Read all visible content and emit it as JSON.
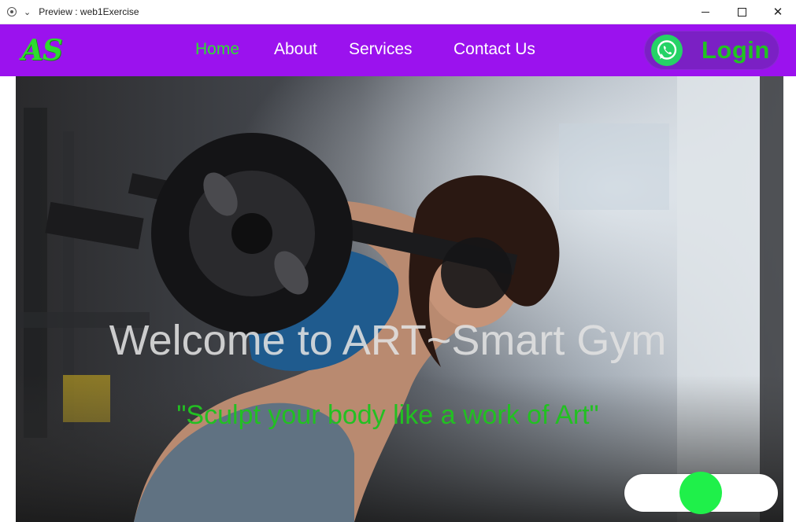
{
  "window": {
    "title": "Preview : web1Exercise",
    "chevron_icon": "chevron-down-icon",
    "record_icon": "record-icon"
  },
  "nav": {
    "logo": "AS",
    "links": [
      {
        "label": "Home",
        "active": true
      },
      {
        "label": "About",
        "active": false
      },
      {
        "label": "Services",
        "active": false
      },
      {
        "label": "Contact Us",
        "active": false
      }
    ],
    "login_label": "Login",
    "whatsapp_icon": "whatsapp-icon"
  },
  "hero": {
    "title": "Welcome to ART~Smart Gym",
    "tagline": "\"Sculpt your body like a work of Art\"",
    "image": "woman-lifting-barbell-in-gym"
  },
  "toggle": {
    "state": "on"
  },
  "colors": {
    "navbar": "#9b12ee",
    "accent_green": "#2ee02e",
    "toggle_knob": "#1ff04a"
  }
}
